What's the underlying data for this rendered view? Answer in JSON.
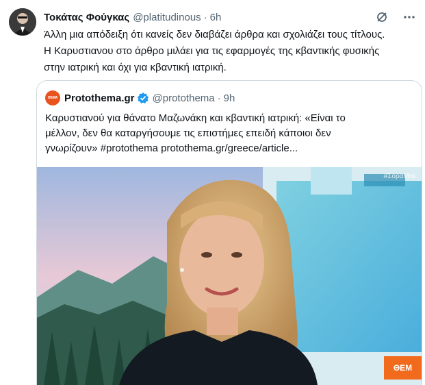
{
  "tweet": {
    "author_name": "Τοκάτας Φούγκας",
    "author_handle": "@platitudinous",
    "separator": "·",
    "time": "6h",
    "text_lines": [
      "Άλλη μια απόδειξη ότι κανείς δεν διαβάζει άρθρα και σχολιάζει τους τίτλους.",
      "Η Καρυστιανου στο άρθρο μιλάει για τις εφαρμογές της κβαντικής φυσικής",
      "στην ιατρική και όχι για κβαντική ιατρική."
    ],
    "more_icon": "more-horizontal-icon",
    "grok_icon": "grok-icon"
  },
  "quote": {
    "logo_text": "ΘΕΜΑ",
    "author_name": "Protothema.gr",
    "author_handle": "@protothema",
    "separator": "·",
    "time": "9h",
    "verified_color": "#1d9bf0",
    "text_lines": [
      "Καρυστιανού για θάνατο Μαζωνάκη και κβαντική ιατρική: «Είναι το",
      "μέλλον, δεν θα καταργήσουμε τις επιστήμες επειδή κάποιοι δεν",
      "γνωρίζουν» #protothema protothema.gr/greece/article..."
    ],
    "media": {
      "badge": "#ΣοραΜαέ",
      "brand": "ΘΕΜ"
    }
  }
}
